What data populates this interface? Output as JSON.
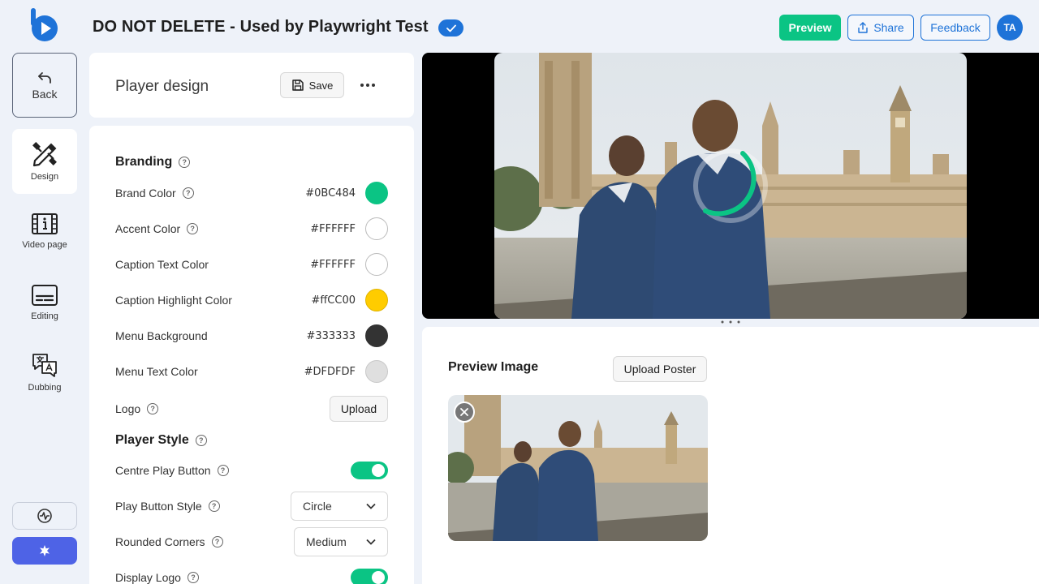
{
  "header": {
    "title": "DO NOT DELETE - Used by Playwright Test",
    "preview_label": "Preview",
    "share_label": "Share",
    "feedback_label": "Feedback",
    "avatar_initials": "TA",
    "accent_color": "#1e73d8",
    "brand_green": "#0bc484"
  },
  "nav": {
    "back_label": "Back",
    "items": [
      {
        "label": "Design",
        "icon": "pencil-ruler-icon",
        "active": true
      },
      {
        "label": "Video page",
        "icon": "film-info-icon",
        "active": false
      },
      {
        "label": "Editing",
        "icon": "subtitles-icon",
        "active": false
      },
      {
        "label": "Dubbing",
        "icon": "translate-chat-icon",
        "active": false
      }
    ],
    "bottom_icons": [
      "activity-icon",
      "sparkle-icon"
    ]
  },
  "design_panel": {
    "title": "Player design",
    "save_label": "Save",
    "more_icon": "more-horizontal-icon"
  },
  "branding": {
    "title": "Branding",
    "colors": [
      {
        "label": "Brand Color",
        "value": "#0BC484",
        "swatch": "#0bc484"
      },
      {
        "label": "Accent Color",
        "value": "#FFFFFF",
        "swatch": "#ffffff"
      },
      {
        "label": "Caption Text Color",
        "value": "#FFFFFF",
        "swatch": "#ffffff"
      },
      {
        "label": "Caption Highlight Color",
        "value": "#ffCC00",
        "swatch": "#ffcc00"
      },
      {
        "label": "Menu Background",
        "value": "#333333",
        "swatch": "#333333"
      },
      {
        "label": "Menu Text Color",
        "value": "#DFDFDF",
        "swatch": "#dfdfdf"
      }
    ],
    "logo_label": "Logo",
    "upload_label": "Upload"
  },
  "player_style": {
    "title": "Player Style",
    "centre_play_label": "Centre Play Button",
    "centre_play_on": true,
    "play_style_label": "Play Button Style",
    "play_style_value": "Circle",
    "rounded_label": "Rounded Corners",
    "rounded_value": "Medium",
    "display_logo_label": "Display Logo",
    "display_logo_on": true
  },
  "preview": {
    "title": "Preview Image",
    "upload_poster_label": "Upload Poster"
  }
}
